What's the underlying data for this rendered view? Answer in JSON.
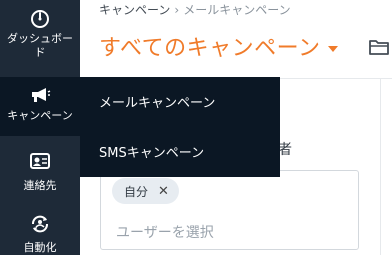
{
  "sidebar": {
    "items": [
      {
        "label": "ダッシュボード",
        "icon": "gauge-icon"
      },
      {
        "label": "キャンペーン",
        "icon": "megaphone-icon"
      },
      {
        "label": "連絡先",
        "icon": "contact-card-icon"
      },
      {
        "label": "自動化",
        "icon": "automation-icon"
      }
    ]
  },
  "breadcrumb": {
    "parent": "キャンペーン",
    "separator": "›",
    "current": "メールキャンペーン"
  },
  "header": {
    "title": "すべてのキャンペーン"
  },
  "dropdown": {
    "items": [
      "メールキャンペーン",
      "SMSキャンペーン"
    ]
  },
  "form": {
    "label_partial": "者",
    "chip": "自分",
    "chip_remove": "✕",
    "placeholder": "ユーザーを選択"
  },
  "colors": {
    "sidebar": "#1e2a38",
    "sidebar_active": "#0b1724",
    "accent": "#f07b2a"
  }
}
